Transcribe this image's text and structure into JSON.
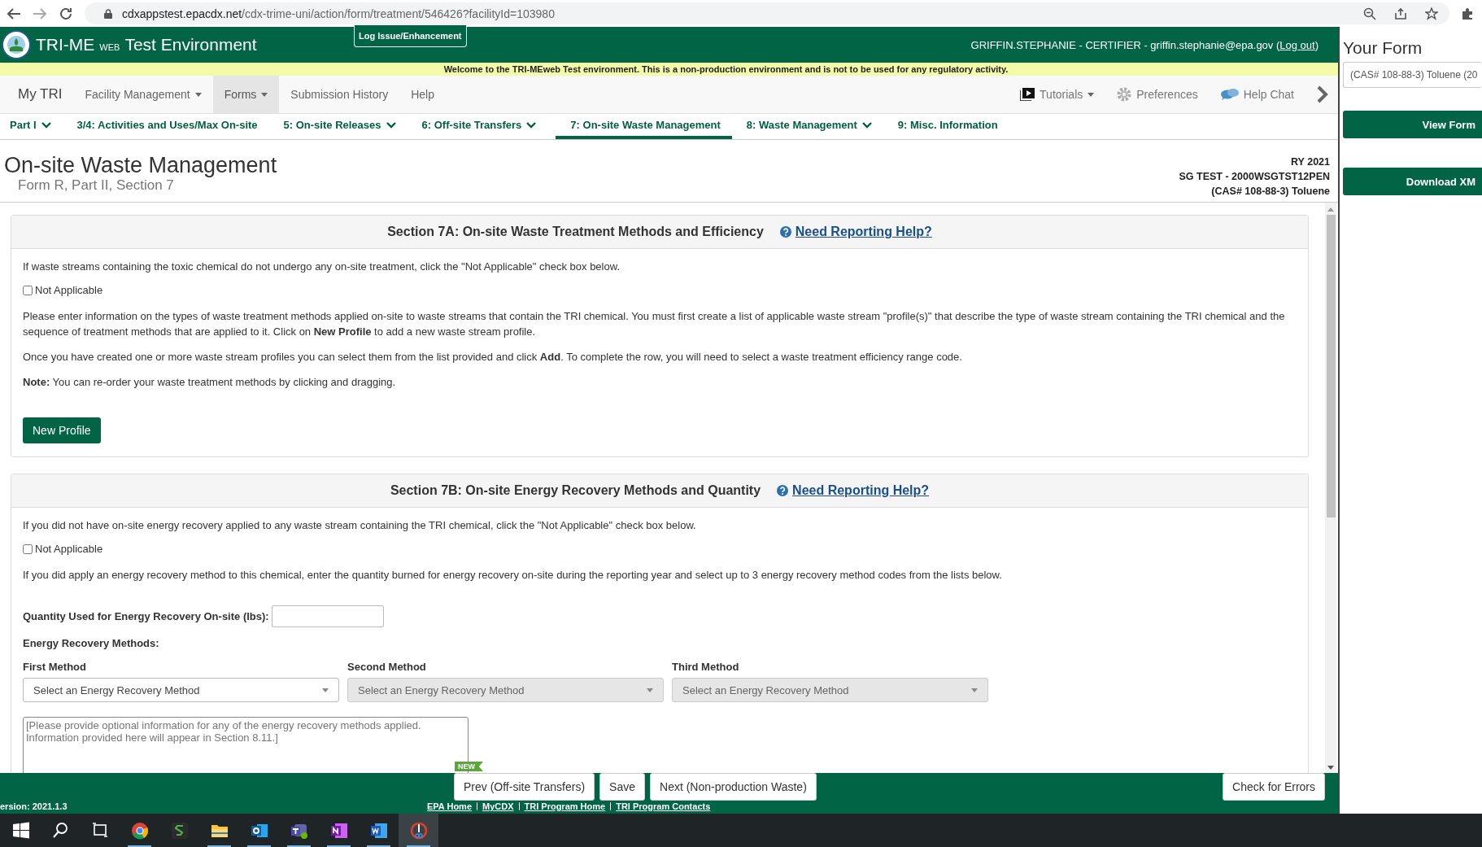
{
  "browser": {
    "url_host": "cdxappstest.epacdx.net",
    "url_path": "/cdx-trime-uni/action/form/treatment/546426?facilityId=103980"
  },
  "header": {
    "title_main": "TRI-ME",
    "title_small": "WEB",
    "title_rest": "Test Environment",
    "log_issue_button": "Log Issue/Enhancement",
    "user_prefix": "GRIFFIN.STEPHANIE - CERTIFIER - griffin.stephanie@epa.gov (",
    "logout_link": "Log out",
    "user_suffix": ")"
  },
  "banner": "Welcome to the TRI-MEweb Test environment. This is a non-production environment and is not to be used for any regulatory activity.",
  "menu": {
    "brand": "My TRI",
    "items": [
      {
        "label": "Facility Management",
        "dropdown": true,
        "selected": false
      },
      {
        "label": "Forms",
        "dropdown": true,
        "selected": true
      },
      {
        "label": "Submission History",
        "dropdown": false,
        "selected": false
      },
      {
        "label": "Help",
        "dropdown": false,
        "selected": false
      }
    ],
    "right_items": [
      {
        "label": "Tutorials",
        "kind": "video",
        "dropdown": true
      },
      {
        "label": "Preferences",
        "kind": "gear",
        "dropdown": false
      },
      {
        "label": "Help Chat",
        "kind": "chat",
        "dropdown": false
      }
    ]
  },
  "tabs": [
    {
      "label": "Part I",
      "dropdown": true,
      "selected": false
    },
    {
      "label": "3/4: Activities and Uses/Max On-site",
      "dropdown": false,
      "selected": false
    },
    {
      "label": "5: On-site Releases",
      "dropdown": true,
      "selected": false
    },
    {
      "label": "6: Off-site Transfers",
      "dropdown": true,
      "selected": false
    },
    {
      "label": "7: On-site Waste Management",
      "dropdown": false,
      "selected": true
    },
    {
      "label": "8: Waste Management",
      "dropdown": true,
      "selected": false
    },
    {
      "label": "9: Misc. Information",
      "dropdown": false,
      "selected": false
    }
  ],
  "page": {
    "title": "On-site Waste Management",
    "subtitle": "Form R, Part II, Section 7",
    "meta": [
      "RY 2021",
      "SG TEST - 2000WSGTST12PEN",
      "(CAS# 108-88-3) Toluene"
    ]
  },
  "section_7a": {
    "heading": "Section 7A: On-site Waste Treatment Methods and Efficiency",
    "help_link": "Need Reporting Help?",
    "intro": "If waste streams containing the toxic chemical do not undergo any on-site treatment, click the \"Not Applicable\" check box below.",
    "not_applicable": {
      "label": "Not Applicable",
      "checked": false
    },
    "paragraphs": [
      "Please enter information on the types of waste treatment methods applied on-site to waste streams that contain the TRI chemical. You must first create a list of applicable waste stream \"profile(s)\" that describe the type of waste stream containing the TRI chemical and the sequence of treatment methods that are applied to it. Click on **New Profile** to add a new waste stream profile.",
      "Once you have created one or more waste stream profiles you can select them from the list provided and click **Add**. To complete the row, you will need to select a waste treatment efficiency range code.",
      "**Note:** You can re-order your waste treatment methods by clicking and dragging."
    ],
    "new_profile_button": "New Profile"
  },
  "section_7b": {
    "heading": "Section 7B: On-site Energy Recovery Methods and Quantity",
    "help_link": "Need Reporting Help?",
    "intro": "If you did not have on-site energy recovery applied to any waste stream containing the TRI chemical, click the \"Not Applicable\" check box below.",
    "not_applicable": {
      "label": "Not Applicable",
      "checked": false
    },
    "paragraph": "If you did apply an energy recovery method to this chemical, enter the quantity burned for energy recovery on-site during the reporting year and select up to 3 energy recovery method codes from the lists below.",
    "quantity_label": "Quantity Used for Energy Recovery On-site (lbs):",
    "methods_label": "Energy Recovery Methods:",
    "methods": [
      {
        "label": "First Method",
        "value": "Select an Energy Recovery Method",
        "disabled": false
      },
      {
        "label": "Second Method",
        "value": "Select an Energy Recovery Method",
        "disabled": true
      },
      {
        "label": "Third Method",
        "value": "Select an Energy Recovery Method",
        "disabled": true
      }
    ],
    "notes_placeholder": "[Please provide optional information for any of the energy recovery methods applied. Information provided here will appear in Section 8.11.]"
  },
  "footer": {
    "new_badge": "NEW",
    "buttons": [
      "Prev (Off-site Transfers)",
      "Save",
      "Next (Non-production Waste)"
    ],
    "check_errors_button": "Check for Errors",
    "version": "ersion: 2021.1.3",
    "links": [
      "EPA Home",
      "MyCDX",
      "TRI Program Home",
      "TRI Program Contacts"
    ]
  },
  "side_panel": {
    "title": "Your Form",
    "form_select": "(CAS# 108-88-3) Toluene (20",
    "buttons": [
      "View Form",
      "Download XM"
    ]
  }
}
